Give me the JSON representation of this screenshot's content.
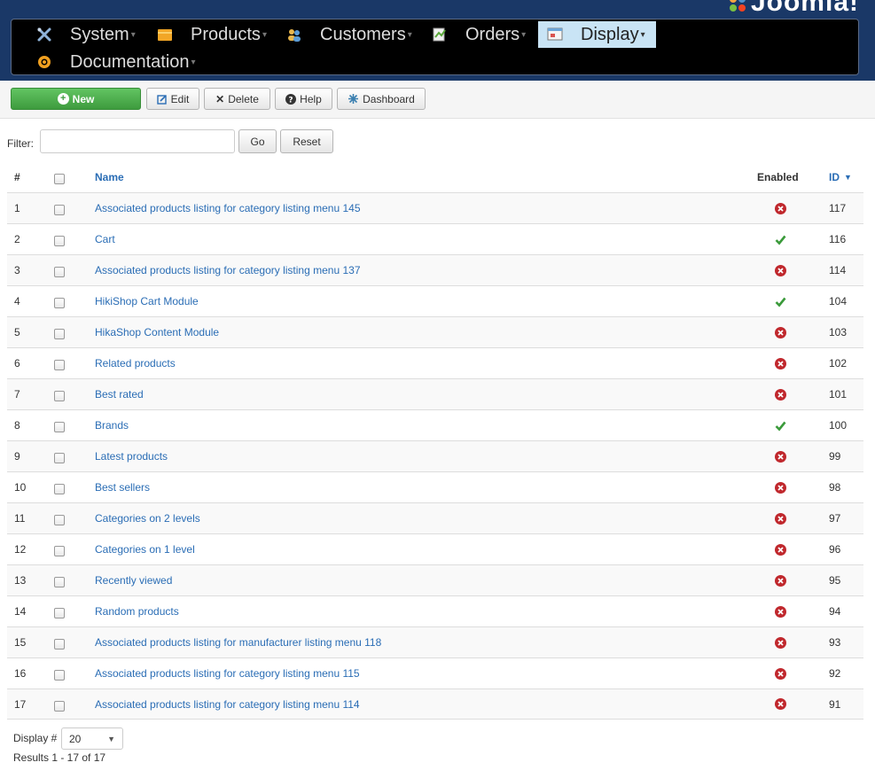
{
  "brand": {
    "name": "Joomla!"
  },
  "menu": [
    {
      "label": "System",
      "icon": "tools-icon"
    },
    {
      "label": "Products",
      "icon": "folder-icon"
    },
    {
      "label": "Customers",
      "icon": "users-icon"
    },
    {
      "label": "Orders",
      "icon": "orders-icon"
    },
    {
      "label": "Display",
      "icon": "display-icon",
      "active": true
    },
    {
      "label": "Documentation",
      "icon": "help-circle-icon"
    }
  ],
  "toolbar": {
    "new_label": "New",
    "edit_label": "Edit",
    "delete_label": "Delete",
    "help_label": "Help",
    "dashboard_label": "Dashboard"
  },
  "filter": {
    "label": "Filter:",
    "value": "",
    "go_label": "Go",
    "reset_label": "Reset"
  },
  "table": {
    "headers": {
      "num": "#",
      "name": "Name",
      "enabled": "Enabled",
      "id": "ID"
    },
    "rows": [
      {
        "num": "1",
        "name": "Associated products listing for category listing menu 145",
        "enabled": false,
        "id": "117"
      },
      {
        "num": "2",
        "name": "Cart",
        "enabled": true,
        "id": "116"
      },
      {
        "num": "3",
        "name": "Associated products listing for category listing menu 137",
        "enabled": false,
        "id": "114"
      },
      {
        "num": "4",
        "name": "HikiShop Cart Module",
        "enabled": true,
        "id": "104"
      },
      {
        "num": "5",
        "name": "HikaShop Content Module",
        "enabled": false,
        "id": "103"
      },
      {
        "num": "6",
        "name": "Related products",
        "enabled": false,
        "id": "102"
      },
      {
        "num": "7",
        "name": "Best rated",
        "enabled": false,
        "id": "101"
      },
      {
        "num": "8",
        "name": "Brands",
        "enabled": true,
        "id": "100"
      },
      {
        "num": "9",
        "name": "Latest products",
        "enabled": false,
        "id": "99"
      },
      {
        "num": "10",
        "name": "Best sellers",
        "enabled": false,
        "id": "98"
      },
      {
        "num": "11",
        "name": "Categories on 2 levels",
        "enabled": false,
        "id": "97"
      },
      {
        "num": "12",
        "name": "Categories on 1 level",
        "enabled": false,
        "id": "96"
      },
      {
        "num": "13",
        "name": "Recently viewed",
        "enabled": false,
        "id": "95"
      },
      {
        "num": "14",
        "name": "Random products",
        "enabled": false,
        "id": "94"
      },
      {
        "num": "15",
        "name": "Associated products listing for manufacturer listing menu 118",
        "enabled": false,
        "id": "93"
      },
      {
        "num": "16",
        "name": "Associated products listing for category listing menu 115",
        "enabled": false,
        "id": "92"
      },
      {
        "num": "17",
        "name": "Associated products listing for category listing menu 114",
        "enabled": false,
        "id": "91"
      }
    ]
  },
  "pagination": {
    "display_label": "Display #",
    "display_value": "20",
    "results": "Results 1 - 17 of 17"
  },
  "colors": {
    "header_bg": "#1a3867",
    "link": "#2a6db5",
    "enabled": "#3a9a3a",
    "disabled": "#c0282d",
    "new_button": "#4cae4c"
  }
}
